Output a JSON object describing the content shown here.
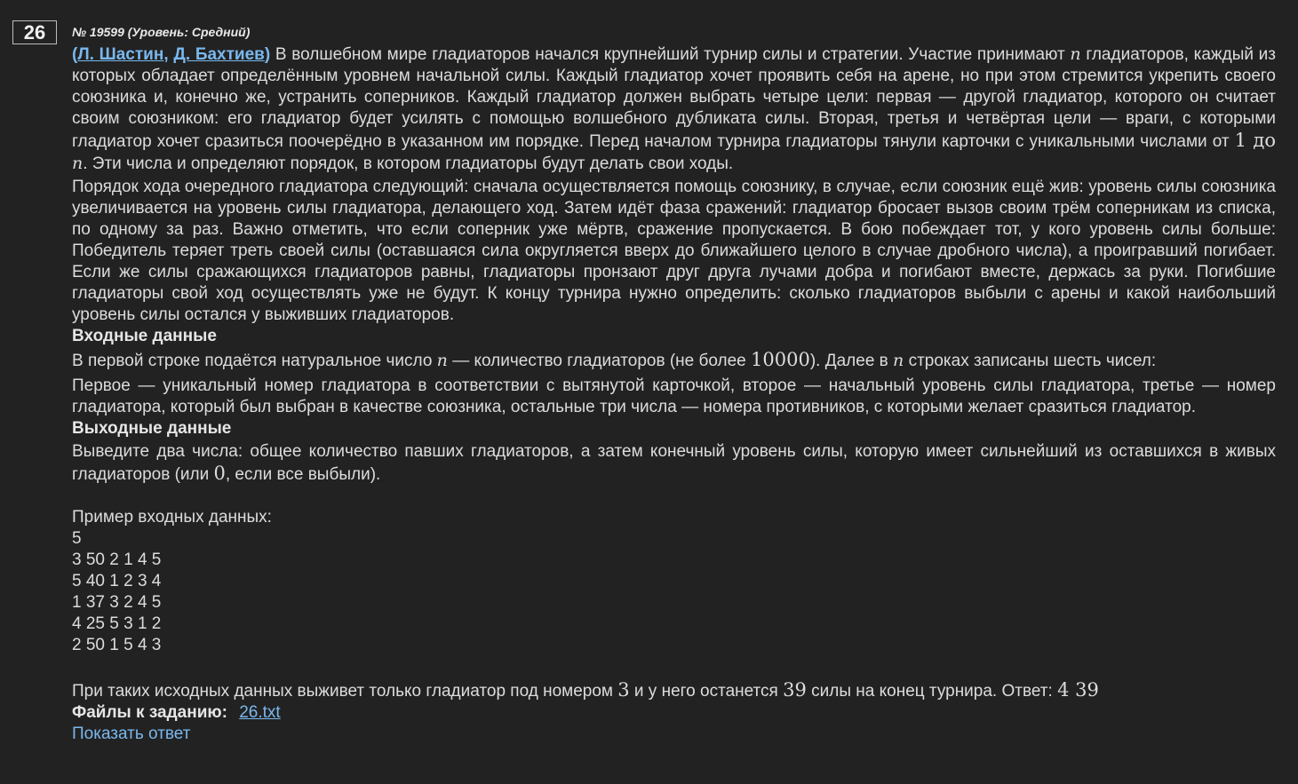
{
  "task": {
    "number": "26",
    "meta": "№ 19599 (Уровень: Средний)",
    "author_open": "(",
    "author1": "Л. Шастин",
    "author_sep": ", ",
    "author2": "Д. Бахтиев",
    "author_close": ")",
    "p1_a": " В волшебном мире гладиаторов начался крупнейший турнир силы и стратегии. Участие принимают ",
    "var_n": "n",
    "p1_b": " гладиаторов, каждый из которых обладает определённым уровнем начальной силы. Каждый гладиатор хочет проявить себя на арене, но при этом стремится укрепить своего союзника и, конечно же, устранить соперников. Каждый гладиатор должен выбрать четыре цели: первая — другой гладиатор, которого он считает своим союзником: его гладиатор будет усилять с помощью волшебного дубликата силы. Вторая, третья и четвёртая цели — враги, с которыми гладиатор хочет сразиться поочерёдно в указанном им порядке. Перед началом турнира гладиаторы тянули карточки с уникальными числами от ",
    "math_range": "1 до ",
    "p1_c": ". Эти числа и определяют порядок, в котором гладиаторы будут делать свои ходы.",
    "p2": "Порядок хода очередного гладиатора следующий: сначала осуществляется помощь союзнику, в случае, если союзник ещё жив: уровень силы союзника увеличивается на уровень силы гладиатора, делающего ход. Затем идёт фаза сражений: гладиатор бросает вызов своим трём соперникам из списка, по одному за раз. Важно отметить, что если соперник уже мёртв, сражение пропускается. В бою побеждает тот, у кого уровень силы больше: Победитель теряет треть своей силы (оставшаяся сила округляется вверх до ближайшего целого в случае дробного числа), а проигравший погибает. Если же силы сражающихся гладиаторов равны, гладиаторы пронзают друг друга лучами добра и погибают вместе, держась за руки. Погибшие гладиаторы свой ход осуществлять уже не будут. К концу турнира нужно определить: сколько гладиаторов выбыли с арены и какой наибольший уровень силы остался у выживших гладиаторов.",
    "input_heading": "Входные данные",
    "input_a": "В первой строке подаётся натуральное число ",
    "input_b": " — количество гладиаторов (не более ",
    "input_max": "10000",
    "input_c": "). Далее в ",
    "input_d": " строках записаны шесть чисел:",
    "input_p2": "Первое — уникальный номер гладиатора в соответствии с вытянутой карточкой, второе — начальный уровень силы гладиатора, третье — номер гладиатора, который был выбран в качестве союзника, остальные три числа — номера противников, с которыми желает сразиться гладиатор.",
    "output_heading": "Выходные данные",
    "output_a": "Выведите два числа: общее количество павших гладиаторов, а затем конечный уровень силы, которую имеет сильнейший из оставшихся в живых гладиаторов (или ",
    "output_zero": "0",
    "output_b": ", если все выбыли).",
    "example_label": "Пример входных данных:",
    "example_lines": [
      "5",
      "3 50 2 1 4 5",
      "5 40 1 2 3 4",
      "1 37 3 2 4 5",
      "4 25 5 3 1 2",
      "2 50 1 5 4 3"
    ],
    "answer_a": "При таких исходных данных выживет только гладиатор под номером ",
    "answer_num": "3",
    "answer_b": " и у него останется ",
    "answer_power": "39",
    "answer_c": " силы на конец турнира. Ответ: ",
    "answer_value": "4 39",
    "files_label": "Файлы к заданию:",
    "file_name": "26.txt",
    "show_answer": "Показать ответ"
  },
  "colors": {
    "background": "#222222",
    "text": "#dcdcdc",
    "link": "#7ab8ee"
  }
}
